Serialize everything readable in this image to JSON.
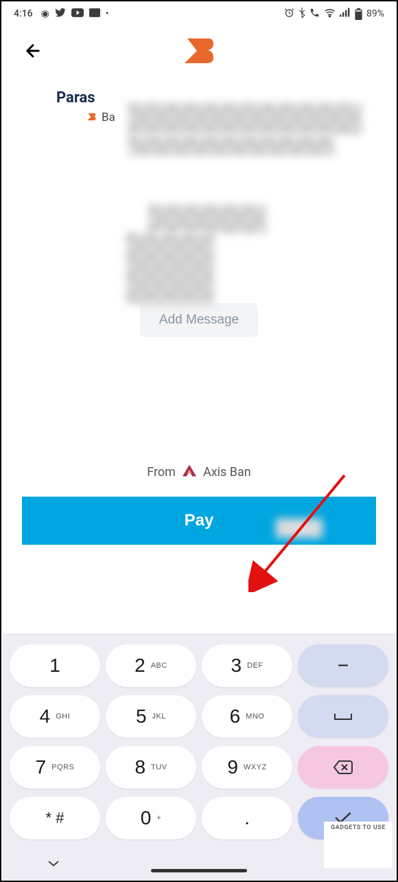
{
  "status": {
    "time": "4:16",
    "battery": "89%"
  },
  "recipient": {
    "name": "Paras",
    "bank_prefix": "Ba"
  },
  "add_message_label": "Add Message",
  "from": {
    "label": "From",
    "bank": "Axis Ban"
  },
  "pay_label": "Pay",
  "keypad": {
    "k1": "1",
    "k1s": "",
    "k2": "2",
    "k2s": "ABC",
    "k3": "3",
    "k3s": "DEF",
    "k4": "4",
    "k4s": "GHI",
    "k5": "5",
    "k5s": "JKL",
    "k6": "6",
    "k6s": "MNO",
    "k7": "7",
    "k7s": "PQRS",
    "k8": "8",
    "k8s": "TUV",
    "k9": "9",
    "k9s": "WXYZ",
    "kstar": "* #",
    "k0": "0",
    "k0s": "+",
    "kdot": "."
  },
  "watermark": "GADGETS TO USE"
}
